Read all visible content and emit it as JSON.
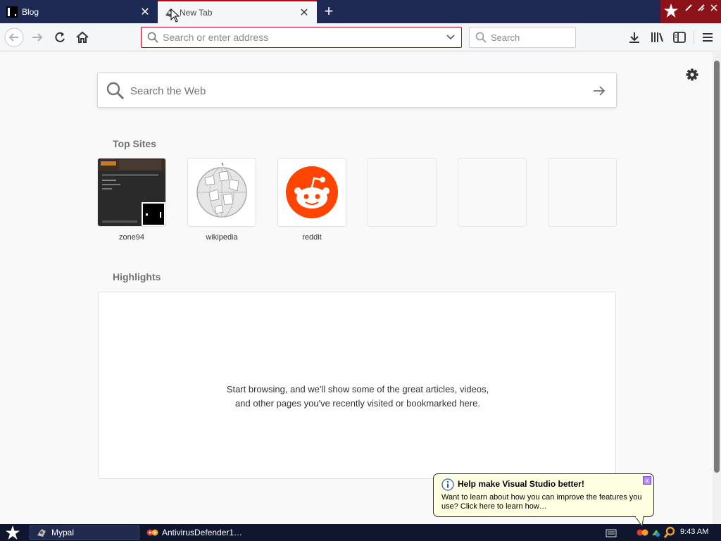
{
  "tabs": [
    {
      "label": "Blog",
      "close": "✕"
    },
    {
      "label": "New Tab",
      "close": "✕"
    }
  ],
  "new_tab_glyph": "+",
  "address_bar": {
    "placeholder": "Search or enter address",
    "value": ""
  },
  "search_bar": {
    "placeholder": "Search"
  },
  "web_search": {
    "placeholder": "Search the Web",
    "arrow": "→"
  },
  "sections": {
    "top_sites": "Top Sites",
    "highlights": "Highlights"
  },
  "top_sites": [
    {
      "label": "zone94"
    },
    {
      "label": "wikipedia"
    },
    {
      "label": "reddit"
    }
  ],
  "highlights_message": "Start browsing, and we'll show some of the great articles, videos, and other pages you've recently visited or bookmarked here.",
  "balloon": {
    "title": "Help make Visual Studio better!",
    "body": "Want to learn about how you can improve the features you use? Click here to learn how…",
    "close": "x"
  },
  "taskbar": {
    "items": [
      {
        "label": "Mypal"
      },
      {
        "label": "AntivirusDefender1…"
      }
    ],
    "clock": "9:43 AM"
  },
  "colors": {
    "tabstrip": "#1e2a54",
    "accent_red": "#c4001d",
    "reddit": "#ff4500",
    "taskbar": "#10162e"
  },
  "icons": [
    "back-icon",
    "forward-icon",
    "reload-icon",
    "home-icon",
    "search-icon",
    "dropdown-icon",
    "downloads-icon",
    "library-icon",
    "sidebar-icon",
    "menu-icon",
    "gear-icon",
    "start-icon"
  ]
}
